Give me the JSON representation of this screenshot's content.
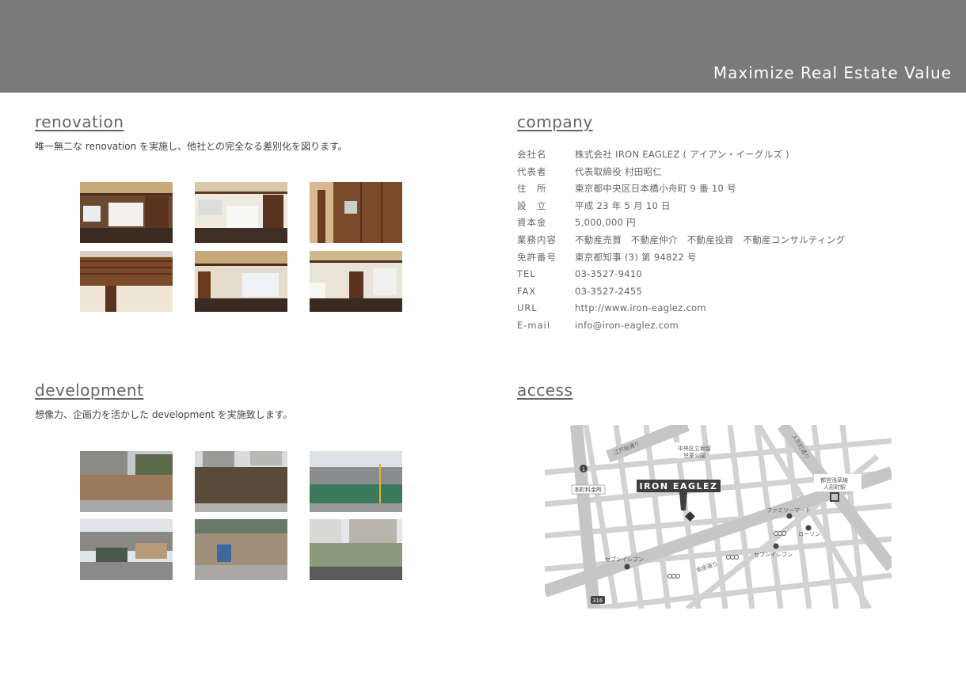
{
  "header": {
    "tagline": "Maximize Real Estate Value"
  },
  "renovation": {
    "title": "renovation",
    "description": "唯一無二な renovation を実施し、他社との完全なる差別化を図ります。"
  },
  "development": {
    "title": "development",
    "description": "想像力、企画力を活かした development を実施致します。"
  },
  "company": {
    "title": "company",
    "rows": [
      {
        "label": "会社名",
        "value": "株式会社 IRON EAGLEZ ( アイアン・イーグルズ )"
      },
      {
        "label": "代表者",
        "value": "代表取締役 村田昭仁"
      },
      {
        "label": "住　所",
        "value": "東京都中央区日本橋小舟町 9 番 10 号"
      },
      {
        "label": "設　立",
        "value": "平成 23 年 5 月 10 日"
      },
      {
        "label": "資本金",
        "value": "5,000,000 円"
      },
      {
        "label": "業務内容",
        "value": "不動産売買　不動産仲介　不動産投資　不動産コンサルティング"
      },
      {
        "label": "免許番号",
        "value": "東京都知事 (3) 第 94822 号"
      },
      {
        "label": "TEL",
        "value": "03-3527-9410"
      },
      {
        "label": "FAX",
        "value": "03-3527-2455"
      },
      {
        "label": "URL",
        "value": "http://www.iron-eaglez.com"
      },
      {
        "label": "E-mail",
        "value": "info@iron-eaglez.com"
      }
    ]
  },
  "access": {
    "title": "access",
    "map": {
      "brand": "IRON EAGLEZ",
      "labels": {
        "edoSakura": "江戸桜通り",
        "park1": "中央区立堀留",
        "park2": "児童公園",
        "ningyocho": "人形町通り",
        "station1": "都営浅草線",
        "station2": "人形町駅",
        "honcho": "本町料金所",
        "familymart": "ファミリーマート",
        "lawson": "ローソン",
        "seven1": "セブンイレブン",
        "seven2": "セブンイレブン",
        "kinza": "金座通り",
        "route1": "1",
        "route316": "316"
      }
    }
  },
  "colors": {
    "banner": "#7a7a7a",
    "road": "#c9c9c9",
    "brand_box": "#3f3f3f"
  }
}
